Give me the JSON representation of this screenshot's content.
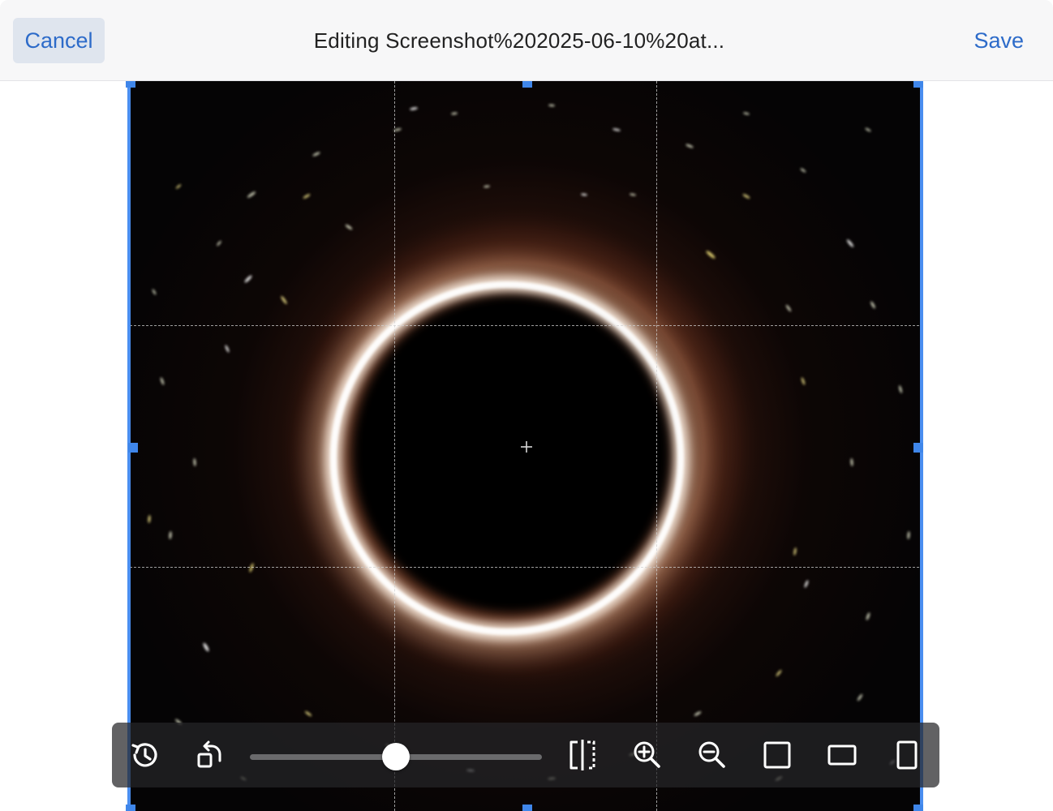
{
  "header": {
    "cancel_label": "Cancel",
    "title": "Editing Screenshot%202025-06-10%20at...",
    "save_label": "Save"
  },
  "toolbar": {
    "tools": [
      {
        "name": "reset-history-icon"
      },
      {
        "name": "rotate-icon"
      },
      {
        "name": "flip-horizontal-icon"
      },
      {
        "name": "zoom-in-icon"
      },
      {
        "name": "zoom-out-icon"
      },
      {
        "name": "aspect-square-icon"
      },
      {
        "name": "aspect-landscape-icon"
      },
      {
        "name": "aspect-portrait-icon"
      }
    ],
    "rotation_slider_value": 0.5
  },
  "colors": {
    "accent": "#2d6bc9",
    "crop_handle": "#3f86ea",
    "toolbar_bg": "#262628"
  }
}
